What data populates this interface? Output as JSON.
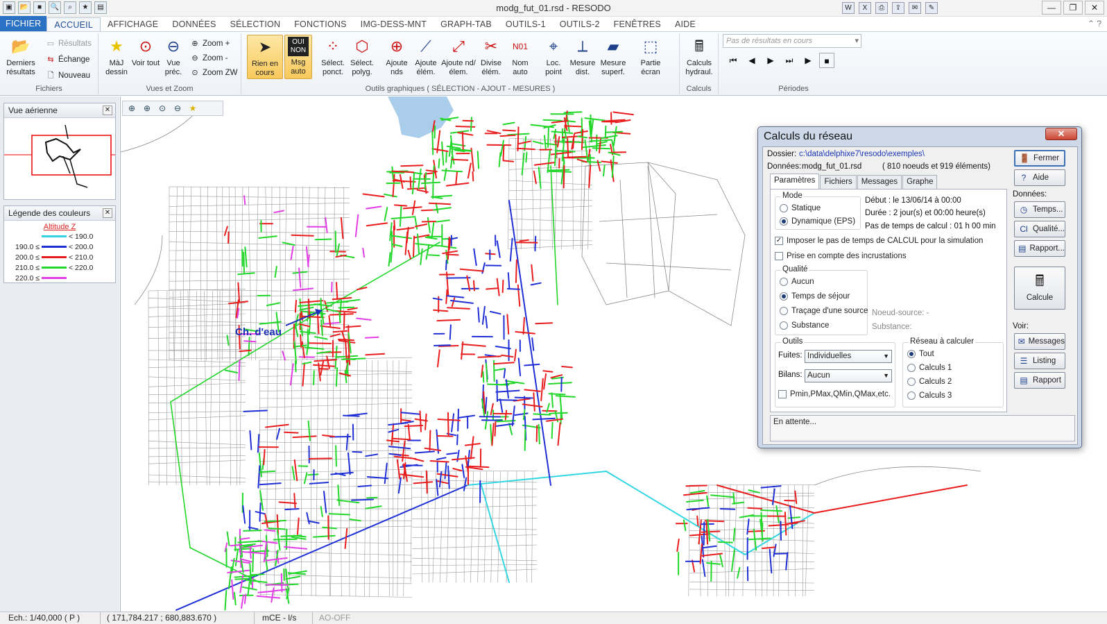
{
  "window": {
    "title": "modg_fut_01.rsd - RESODO",
    "quick_access": [
      "app-icon",
      "open-icon",
      "save-icon",
      "preview-icon",
      "zoom-icon",
      "star-icon",
      "window-icon"
    ],
    "controls": [
      "—",
      "❐",
      "✕"
    ]
  },
  "menu": {
    "tabs": [
      "FICHIER",
      "ACCUEIL",
      "AFFICHAGE",
      "DONNÉES",
      "SÉLECTION",
      "FONCTIONS",
      "IMG-DESS-MNT",
      "GRAPH-TAB",
      "OUTILS-1",
      "OUTILS-2",
      "FENÊTRES",
      "AIDE"
    ],
    "active": "ACCUEIL",
    "right": "⌃ ?"
  },
  "ribbon": {
    "fichiers": {
      "label": "Fichiers",
      "derniers": "Derniers résultats",
      "resultats": "Résultats",
      "echange": "Échange",
      "nouveau": "Nouveau"
    },
    "vues": {
      "label": "Vues et Zoom",
      "maj": "MàJ dessin",
      "voir": "Voir tout",
      "prec": "Vue préc.",
      "zoom_plus": "Zoom +",
      "zoom_minus": "Zoom -",
      "zoom_zw": "Zoom ZW"
    },
    "outils": {
      "label": "Outils graphiques ( SÉLECTION - AJOUT - MESURES )",
      "rien": "Rien en cours",
      "msg": "Msg auto",
      "msg_icon_text": "OUI NON",
      "select_ponct": "Sélect. ponct.",
      "select_polyg": "Sélect. polyg.",
      "ajoute_nds": "Ajoute nds",
      "ajoute_elem": "Ajoute élém.",
      "ajoute_nd_elem": "Ajoute nd/élem.",
      "divise": "Divise élém.",
      "nom_auto": "Nom auto",
      "loc": "Loc. point",
      "mesure_dist": "Mesure dist.",
      "mesure_sup": "Mesure superf.",
      "partie": "Partie écran"
    },
    "calculs": {
      "label": "Calculs",
      "hydraul": "Calculs hydraul."
    },
    "periodes": {
      "label": "Périodes",
      "placeholder": "Pas de résultats en cours"
    }
  },
  "aerial": {
    "title": "Vue aérienne"
  },
  "legend": {
    "title": "Légende des couleurs",
    "subtitle": "Altitude Z",
    "rows": [
      {
        "lo": "",
        "hi": "< 190.0",
        "color": "#33d6e0"
      },
      {
        "lo": "190.0 ≤",
        "hi": "< 200.0",
        "color": "#1f2fd6"
      },
      {
        "lo": "200.0 ≤",
        "hi": "< 210.0",
        "color": "#e81c1c"
      },
      {
        "lo": "210.0 ≤",
        "hi": "< 220.0",
        "color": "#22d62a"
      },
      {
        "lo": "220.0 ≤",
        "hi": "",
        "color": "#e23ee6"
      }
    ]
  },
  "map": {
    "annotation": "Ch. d'eau"
  },
  "status": {
    "scale": "Ech.: 1/40,000   ( P )",
    "coords": "( 171,784.217 ; 680,883.670 )",
    "units": "mCE  -  l/s",
    "ao": "AO-OFF"
  },
  "dialog": {
    "title": "Calculs du réseau",
    "close": "✕",
    "dossier_label": "Dossier:",
    "dossier_value": "c:\\data\\delphixe7\\resodo\\exemples\\",
    "donnees_label": "Données:",
    "donnees_value": "modg_fut_01.rsd",
    "noeuds": "( 810   noeuds et   919   éléments)",
    "tabs": [
      "Paramètres",
      "Fichiers",
      "Messages",
      "Graphe"
    ],
    "mode_label": "Mode",
    "statique": "Statique",
    "dynamique": "Dynamique (EPS)",
    "debut": "Début : le 13/06/14 à 00:00",
    "duree": "Durée : 2 jour(s) et 00:00 heure(s)",
    "pas": "Pas de temps de calcul :  01 h 00 min",
    "imposer": "Imposer le pas de temps de CALCUL pour la simulation",
    "incrustations": "Prise en compte des incrustations",
    "qualite_label": "Qualité",
    "aucun": "Aucun",
    "temps_sejour": "Temps de séjour",
    "tracage": "Traçage d'une source",
    "substance": "Substance",
    "noeud_source": "Noeud-source: -",
    "substance_label": "Substance:",
    "outils_label": "Outils",
    "fuites_label": "Fuites:",
    "fuites_value": "Individuelles",
    "bilans_label": "Bilans:",
    "bilans_value": "Aucun",
    "pmin": "Pmin,PMax,QMin,QMax,etc.",
    "reseau_label": "Réseau à calculer",
    "tout": "Tout",
    "calcul1": "Calculs 1",
    "calcul2": "Calculs 2",
    "calcul3": "Calculs 3",
    "fermer": "Fermer",
    "aide": "Aide",
    "donnees_section": "Données:",
    "temps_btn": "Temps...",
    "qualite_btn": "Qualité...",
    "rapport_btn": "Rapport...",
    "calcule": "Calcule",
    "voir": "Voir:",
    "messages_btn": "Messages",
    "listing_btn": "Listing",
    "rapport2_btn": "Rapport",
    "status": "En attente..."
  }
}
